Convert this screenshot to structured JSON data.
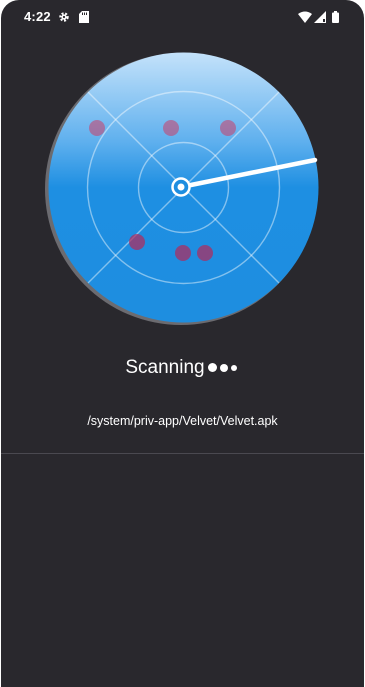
{
  "status_bar": {
    "time": "4:22",
    "icons": [
      "gear-icon",
      "sd-card-icon",
      "wifi-icon",
      "signal-icon",
      "battery-icon"
    ]
  },
  "scanner": {
    "status_label": "Scanning",
    "current_path": "/system/priv-app/Velvet/Velvet.apk"
  },
  "colors": {
    "background": "#29282d",
    "radar_light": "#a9d3f5",
    "radar_dark": "#1e8ee0",
    "target": "#cc3c66"
  }
}
